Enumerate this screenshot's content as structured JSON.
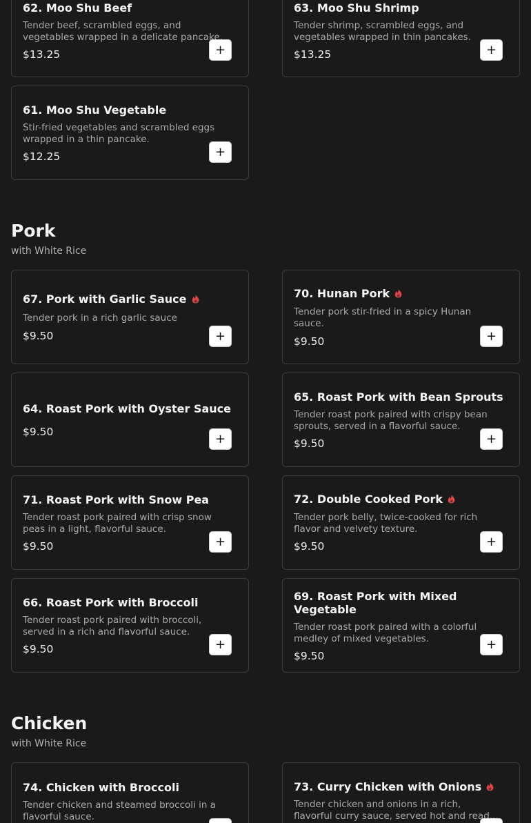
{
  "colors": {
    "background": "#1a1a1a",
    "card_border": "#3d3d3d",
    "spicy": "#e04848"
  },
  "moo_shu": {
    "items": [
      {
        "title": "62. Moo Shu Beef",
        "desc": [
          "Tender beef, scrambled eggs, and",
          "vegetables wrapped in a delicate pancake."
        ],
        "price": "$13.25",
        "spicy": false
      },
      {
        "title": "63. Moo Shu Shrimp",
        "desc": [
          "Tender shrimp, scrambled eggs, and",
          "vegetables wrapped in thin pancakes."
        ],
        "price": "$13.25",
        "spicy": false
      },
      {
        "title": "61. Moo Shu Vegetable",
        "desc": [
          "Stir-fried vegetables and scrambled eggs",
          "wrapped in a thin pancake."
        ],
        "price": "$12.25",
        "spicy": false
      }
    ]
  },
  "pork": {
    "title": "Pork",
    "subtitle": "with White Rice",
    "items": [
      {
        "title": "67. Pork with Garlic Sauce",
        "desc": [
          "Tender pork in a rich garlic sauce"
        ],
        "price": "$9.50",
        "spicy": true
      },
      {
        "title": "70. Hunan Pork",
        "desc": [
          "Tender pork stir-fried in a spicy Hunan",
          "sauce."
        ],
        "price": "$9.50",
        "spicy": true
      },
      {
        "title": "64. Roast Pork with Oyster Sauce",
        "desc": [],
        "price": "$9.50",
        "spicy": false
      },
      {
        "title": "65. Roast Pork with Bean Sprouts",
        "desc": [
          "Tender roast pork paired with crispy bean",
          "sprouts, served in a flavorful sauce."
        ],
        "price": "$9.50",
        "spicy": false
      },
      {
        "title": "71. Roast Pork with Snow Pea",
        "desc": [
          "Tender roast pork paired with crisp snow",
          "peas in a light, flavorful sauce."
        ],
        "price": "$9.50",
        "spicy": false
      },
      {
        "title": "72. Double Cooked Pork",
        "desc": [
          "Tender pork belly, twice-cooked for rich",
          "flavor and velvety texture."
        ],
        "price": "$9.50",
        "spicy": true
      },
      {
        "title": "66. Roast Pork with Broccoli",
        "desc": [
          "Tender roast pork paired with broccoli,",
          "served in a rich and flavorful sauce."
        ],
        "price": "$9.50",
        "spicy": false
      },
      {
        "title": [
          "69. Roast Pork with Mixed",
          "Vegetable"
        ],
        "desc": [
          "Tender roast pork paired with a colorful",
          "medley of mixed vegetables."
        ],
        "price": "$9.50",
        "spicy": false
      }
    ]
  },
  "chicken": {
    "title": "Chicken",
    "subtitle": "with White Rice",
    "items": [
      {
        "title": "74. Chicken with Broccoli",
        "desc": [
          "Tender chicken and steamed broccoli in a",
          "flavorful sauce."
        ],
        "price": "",
        "spicy": false
      },
      {
        "title": "73. Curry Chicken with Onions",
        "desc": [
          "Tender chicken and onions in a rich,",
          "flavorful curry sauce, served hot and read..."
        ],
        "price": "",
        "spicy": true
      }
    ]
  },
  "add_button_label": "+"
}
